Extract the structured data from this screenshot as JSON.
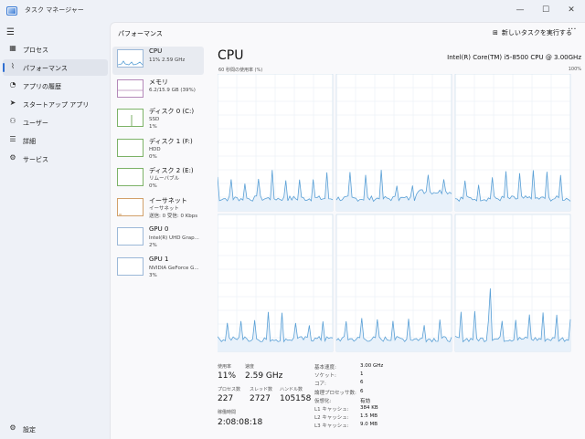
{
  "window": {
    "title": "タスク マネージャー",
    "minimize": "—",
    "maximize": "☐",
    "close": "✕"
  },
  "sidebar": {
    "items": [
      {
        "label": "プロセス",
        "icon": "grid-icon",
        "glyph": "▦"
      },
      {
        "label": "パフォーマンス",
        "icon": "performance-icon",
        "glyph": "⌇",
        "active": true
      },
      {
        "label": "アプリの履歴",
        "icon": "history-icon",
        "glyph": "◔"
      },
      {
        "label": "スタートアップ アプリ",
        "icon": "startup-icon",
        "glyph": "➤"
      },
      {
        "label": "ユーザー",
        "icon": "users-icon",
        "glyph": "⚇"
      },
      {
        "label": "詳細",
        "icon": "list-icon",
        "glyph": "☰"
      },
      {
        "label": "サービス",
        "icon": "services-icon",
        "glyph": "⚙"
      }
    ],
    "settings": {
      "label": "設定",
      "icon": "gear-icon",
      "glyph": "⚙"
    }
  },
  "header": {
    "title": "パフォーマンス",
    "run_task": "新しいタスクを実行する",
    "more": "···"
  },
  "devices": [
    {
      "name": "CPU",
      "sub1": "11%  2.59 GHz",
      "sub2": "",
      "sub3": "",
      "kind": "cpu"
    },
    {
      "name": "メモリ",
      "sub1": "6.2/15.9 GB (39%)",
      "sub2": "",
      "sub3": "",
      "kind": "mem"
    },
    {
      "name": "ディスク 0 (C:)",
      "sub1": "SSD",
      "sub2": "1%",
      "sub3": "",
      "kind": "disk"
    },
    {
      "name": "ディスク 1 (F:)",
      "sub1": "HDD",
      "sub2": "0%",
      "sub3": "",
      "kind": "disk"
    },
    {
      "name": "ディスク 2 (E:)",
      "sub1": "リムーバブル",
      "sub2": "0%",
      "sub3": "",
      "kind": "disk"
    },
    {
      "name": "イーサネット",
      "sub1": "イーサネット",
      "sub2": "送信: 0  受信: 0 Kbps",
      "sub3": "",
      "kind": "eth"
    },
    {
      "name": "GPU 0",
      "sub1": "Intel(R) UHD Grap...",
      "sub2": "2%",
      "sub3": "",
      "kind": "gpu"
    },
    {
      "name": "GPU 1",
      "sub1": "NVIDIA GeForce G...",
      "sub2": "3%",
      "sub3": "",
      "kind": "gpu"
    }
  ],
  "main": {
    "title": "CPU",
    "model": "Intel(R) Core(TM) i5-8500 CPU @ 3.00GHz",
    "graph_label": "60 秒間の使用率 (%)",
    "graph_max": "100%",
    "colors": {
      "line": "#5aa0d6",
      "fill": "#e8f1fa",
      "grid": "#dfe8f1",
      "border": "#c4d7ea"
    }
  },
  "stats": {
    "usage_label": "使用率",
    "usage": "11%",
    "speed_label": "速度",
    "speed": "2.59 GHz",
    "processes_label": "プロセス数",
    "processes": "227",
    "threads_label": "スレッド数",
    "threads": "2727",
    "handles_label": "ハンドル数",
    "handles": "105158",
    "uptime_label": "稼働時間",
    "uptime": "2:08:08:18"
  },
  "specs": [
    {
      "k": "基本速度:",
      "v": "3.00 GHz"
    },
    {
      "k": "ソケット:",
      "v": "1"
    },
    {
      "k": "コア:",
      "v": "6"
    },
    {
      "k": "論理プロセッサ数:",
      "v": "6"
    },
    {
      "k": "仮想化:",
      "v": "有効"
    },
    {
      "k": "L1 キャッシュ:",
      "v": "384 KB"
    },
    {
      "k": "L2 キャッシュ:",
      "v": "1.5 MB"
    },
    {
      "k": "L3 キャッシュ:",
      "v": "9.0 MB"
    }
  ]
}
